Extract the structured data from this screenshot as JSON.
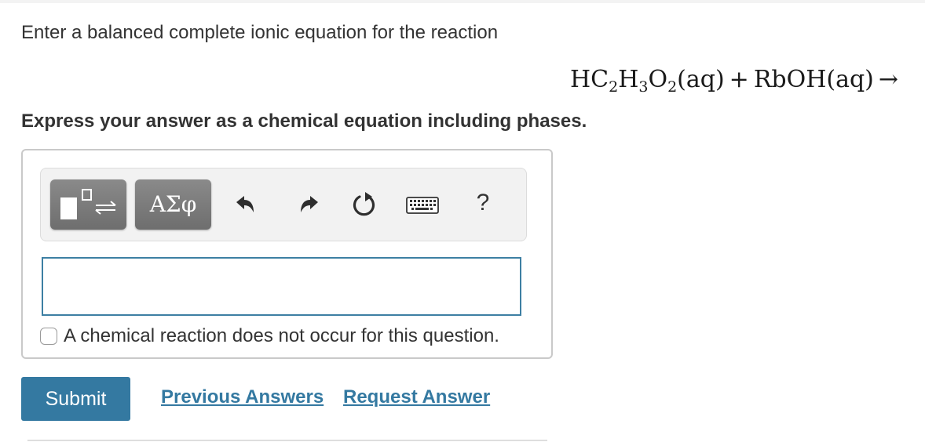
{
  "question": {
    "prompt": "Enter a balanced complete ionic equation for the reaction",
    "equation": {
      "reactant1": {
        "parts": [
          "HC",
          "2",
          "H",
          "3",
          "O",
          "2",
          "(aq)"
        ]
      },
      "plus": "+",
      "reactant2": "RbOH(aq)",
      "arrow": "→"
    },
    "instruction": "Express your answer as a chemical equation including phases."
  },
  "toolbar": {
    "templates_icon": "templates-reaction-icon",
    "greek_label": "ΑΣφ",
    "undo_icon": "undo-icon",
    "redo_icon": "redo-icon",
    "reset_icon": "reset-icon",
    "keyboard_icon": "keyboard-icon",
    "help_label": "?"
  },
  "answer": {
    "value": "",
    "no_reaction_label": "A chemical reaction does not occur for this question.",
    "no_reaction_checked": false
  },
  "actions": {
    "submit_label": "Submit",
    "previous_answers_label": "Previous Answers",
    "request_answer_label": "Request Answer"
  },
  "colors": {
    "accent": "#3479a1",
    "input_border": "#3d7fa3",
    "toolbar_button": "#7a7a7a"
  }
}
